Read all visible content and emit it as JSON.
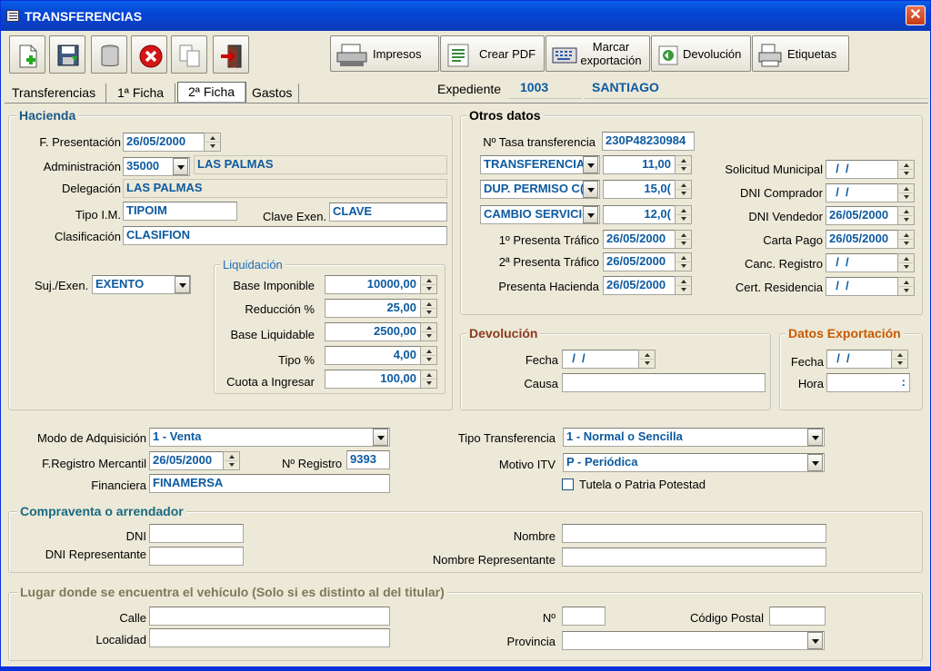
{
  "window": {
    "title": "TRANSFERENCIAS",
    "close": "✕"
  },
  "toolbar": {
    "icons": [
      "new-document-icon",
      "save-icon",
      "trash-icon",
      "cancel-icon",
      "copy-icon",
      "exit-door-icon"
    ],
    "buttons": [
      {
        "label": "Impresos",
        "icon": "printer-icon"
      },
      {
        "label": "Crear PDF",
        "icon": "pdf-icon"
      },
      {
        "label": "Marcar\nexportación",
        "icon": "keyboard-icon"
      },
      {
        "label": "Devolución",
        "icon": "return-icon"
      },
      {
        "label": "Etiquetas",
        "icon": "labels-icon"
      }
    ]
  },
  "tabs": [
    {
      "label": "Transferencias"
    },
    {
      "label": "1ª Ficha"
    },
    {
      "label": "2ª Ficha",
      "selected": true
    },
    {
      "label": "Gastos"
    }
  ],
  "expediente": {
    "label": "Expediente",
    "number": "1003",
    "name": "SANTIAGO"
  },
  "hacienda": {
    "title": "Hacienda",
    "f_presentacion": {
      "label": "F. Presentación",
      "value": "26/05/2000"
    },
    "administracion": {
      "label": "Administración",
      "code": "35000",
      "name": "LAS PALMAS"
    },
    "delegacion": {
      "label": "Delegación",
      "value": "LAS PALMAS"
    },
    "tipo_im": {
      "label": "Tipo I.M.",
      "value": "TIPOIM"
    },
    "clave_exen": {
      "label": "Clave Exen.",
      "value": "CLAVE"
    },
    "clasificacion": {
      "label": "Clasificación",
      "value": "CLASIFION"
    },
    "suj_exen": {
      "label": "Suj./Exen.",
      "value": "EXENTO"
    },
    "liquidacion": {
      "title": "Liquidación",
      "base_imponible": {
        "label": "Base Imponible",
        "value": "10000,00"
      },
      "reduccion": {
        "label": "Reducción %",
        "value": "25,00"
      },
      "base_liquidable": {
        "label": "Base Liquidable",
        "value": "2500,00"
      },
      "tipo": {
        "label": "Tipo %",
        "value": "4,00"
      },
      "cuota": {
        "label": "Cuota a Ingresar",
        "value": "100,00"
      }
    }
  },
  "otros": {
    "title": "Otros datos",
    "tasa": {
      "label": "Nº Tasa transferencia",
      "value": "230P48230984"
    },
    "conceptos": [
      {
        "name": "TRANSFERENCIA",
        "value": "11,00"
      },
      {
        "name": "DUP. PERMISO C(",
        "value": "15,0("
      },
      {
        "name": "CAMBIO SERVICI(",
        "value": "12,0("
      }
    ],
    "pres1": {
      "label": "1º Presenta Tráfico",
      "value": "26/05/2000"
    },
    "pres2": {
      "label": "2ª Presenta Tráfico",
      "value": "26/05/2000"
    },
    "pres_hac": {
      "label": "Presenta Hacienda",
      "value": "26/05/2000"
    },
    "solicitud": {
      "label": "Solicitud Municipal",
      "value": "  /  /"
    },
    "dni_comprador": {
      "label": "DNI Comprador",
      "value": "  /  /"
    },
    "dni_vendedor": {
      "label": "DNI Vendedor",
      "value": "26/05/2000"
    },
    "carta_pago": {
      "label": "Carta Pago",
      "value": "26/05/2000"
    },
    "canc_registro": {
      "label": "Canc. Registro",
      "value": "  /  /"
    },
    "cert_residencia": {
      "label": "Cert. Residencia",
      "value": "  /  /"
    }
  },
  "devolucion": {
    "title": "Devolución",
    "fecha": {
      "label": "Fecha",
      "value": "  /  /"
    },
    "causa": {
      "label": "Causa",
      "value": ""
    }
  },
  "exportacion": {
    "title": "Datos Exportación",
    "fecha": {
      "label": "Fecha",
      "value": "  /  /"
    },
    "hora": {
      "label": "Hora",
      "value": ":"
    }
  },
  "adquisicion": {
    "modo": {
      "label": "Modo de Adquisición",
      "value": "1 - Venta"
    },
    "f_registro": {
      "label": "F.Registro Mercantil",
      "value": "26/05/2000"
    },
    "n_registro": {
      "label": "Nº Registro",
      "value": "9393"
    },
    "financiera": {
      "label": "Financiera",
      "value": "FINAMERSA"
    },
    "tipo_transf": {
      "label": "Tipo Transferencia",
      "value": "1 - Normal o Sencilla"
    },
    "motivo_itv": {
      "label": "Motivo ITV",
      "value": "P - Periódica"
    },
    "tutela": {
      "label": "Tutela o Patria Potestad"
    }
  },
  "compraventa": {
    "title": "Compraventa o arrendador",
    "dni": {
      "label": "DNI",
      "value": ""
    },
    "dni_rep": {
      "label": "DNI Representante",
      "value": ""
    },
    "nombre": {
      "label": "Nombre",
      "value": ""
    },
    "nombre_rep": {
      "label": "Nombre Representante",
      "value": ""
    }
  },
  "lugar": {
    "title": "Lugar donde se encuentra el vehículo (Solo si es distinto al del titular)",
    "calle": {
      "label": "Calle",
      "value": ""
    },
    "numero": {
      "label": "Nº",
      "value": ""
    },
    "cp": {
      "label": "Código Postal",
      "value": ""
    },
    "localidad": {
      "label": "Localidad",
      "value": ""
    },
    "provincia": {
      "label": "Provincia",
      "value": ""
    }
  },
  "colors": {
    "titlebar": "#0346d6",
    "field_text": "#0d5aa0",
    "group_title_blue": "#1b5a8a",
    "group_title_red": "#8b3a1f",
    "group_title_orange": "#c85a00",
    "group_title_olive": "#7a7a5a",
    "group_title_teal": "#1a6a80"
  }
}
